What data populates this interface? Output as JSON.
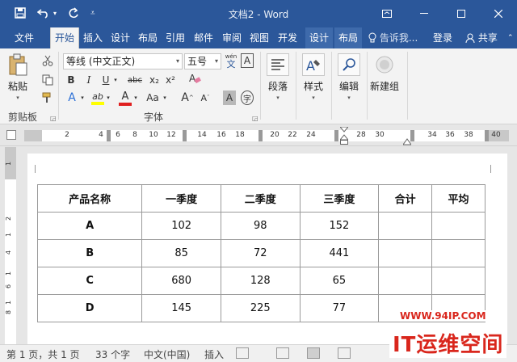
{
  "titlebar": {
    "save_icon": "save-icon",
    "undo_icon": "undo-icon",
    "redo_icon": "redo-icon",
    "customize_icon": "customize-qat-icon",
    "title": "文档2 - Word",
    "minimize_icon": "minimize-icon",
    "maximize_icon": "maximize-icon",
    "close_icon": "close-icon"
  },
  "tabs": {
    "file": "文件",
    "home": "开始",
    "insert": "插入",
    "design": "设计",
    "layout": "布局",
    "references": "引用",
    "mailings": "邮件",
    "review": "审阅",
    "view": "视图",
    "developer": "开发",
    "table_design": "设计",
    "table_layout": "布局",
    "tell_me": "告诉我...",
    "login": "登录",
    "share": "共享"
  },
  "ribbon": {
    "clipboard": {
      "paste_label": "粘贴",
      "group_label": "剪贴板"
    },
    "font": {
      "font_name": "等线 (中文正文)",
      "font_size": "五号",
      "wen_label": "wén",
      "wen_char": "文",
      "a_box": "A",
      "bold": "B",
      "italic": "I",
      "underline": "U",
      "strike": "abc",
      "sub": "x₂",
      "sup": "x²",
      "font_color": "A",
      "highlight": "ab",
      "text_effect": "A",
      "change_case": "Aa",
      "grow": "A",
      "shrink": "A",
      "char_shading": "A",
      "enclose": "字",
      "group_label": "字体"
    },
    "paragraph_label": "段落",
    "styles_label": "样式",
    "editing_label": "编辑",
    "newgroup_label": "新建组"
  },
  "ruler": {
    "numbers": [
      "2",
      "4",
      "6",
      "8",
      "10",
      "12",
      "14",
      "16",
      "18",
      "20",
      "22",
      "24",
      "28",
      "30",
      "34",
      "36",
      "38",
      "40"
    ],
    "vnumbers": [
      "1",
      "2",
      "1",
      "4",
      "1",
      "6",
      "1",
      "8"
    ]
  },
  "table": {
    "headers": [
      "产品名称",
      "一季度",
      "二季度",
      "三季度",
      "合计",
      "平均"
    ],
    "rows": [
      [
        "A",
        "102",
        "98",
        "152",
        "",
        ""
      ],
      [
        "B",
        "85",
        "72",
        "441",
        "",
        ""
      ],
      [
        "C",
        "680",
        "128",
        "65",
        "",
        ""
      ],
      [
        "D",
        "145",
        "225",
        "77",
        "",
        ""
      ]
    ]
  },
  "status": {
    "page": "第 1 页，共 1 页",
    "words": "33 个字",
    "lang": "中文(中国)",
    "mode": "插入"
  },
  "watermark": {
    "url": "WWW.94IP.COM",
    "text": "IT运维空间"
  }
}
